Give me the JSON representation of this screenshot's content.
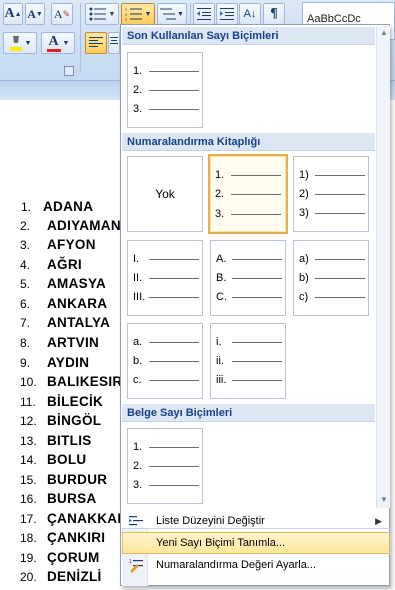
{
  "ribbon": {
    "grow_font_label": "A",
    "shrink_font_label": "A",
    "clear_format_label": "A",
    "font_color_label": "A",
    "styles_preview": "AaBbCcDc",
    "accent": "#c2d7f1"
  },
  "document": {
    "items": [
      {
        "number": "1.",
        "name": "ADANA"
      },
      {
        "number": "2.",
        "name": "ADIYAMAN"
      },
      {
        "number": "3.",
        "name": "AFYON"
      },
      {
        "number": "4.",
        "name": "AĞRI"
      },
      {
        "number": "5.",
        "name": "AMASYA"
      },
      {
        "number": "6.",
        "name": "ANKARA"
      },
      {
        "number": "7.",
        "name": "ANTALYA"
      },
      {
        "number": "8.",
        "name": "ARTVIN"
      },
      {
        "number": "9.",
        "name": "AYDIN"
      },
      {
        "number": "10.",
        "name": "BALIKESIR"
      },
      {
        "number": "11.",
        "name": "BİLECİK"
      },
      {
        "number": "12.",
        "name": "BİNGÖL"
      },
      {
        "number": "13.",
        "name": "BITLIS"
      },
      {
        "number": "14.",
        "name": "BOLU"
      },
      {
        "number": "15.",
        "name": "BURDUR"
      },
      {
        "number": "16.",
        "name": "BURSA"
      },
      {
        "number": "17.",
        "name": "ÇANAKKALE"
      },
      {
        "number": "18.",
        "name": "ÇANKIRI"
      },
      {
        "number": "19.",
        "name": "ÇORUM"
      },
      {
        "number": "20.",
        "name": "DENİZLİ"
      }
    ]
  },
  "gallery": {
    "recent_header": "Son Kullanılan Sayı Biçimleri",
    "library_header": "Numaralandırma Kitaplığı",
    "document_header": "Belge Sayı Biçimleri",
    "none_label": "Yok",
    "recent_tile": [
      "1.",
      "2.",
      "3."
    ],
    "library_tiles": [
      [
        "1.",
        "2.",
        "3."
      ],
      [
        "1)",
        "2)",
        "3)"
      ],
      [
        "I.",
        "II.",
        "III."
      ],
      [
        "A.",
        "B.",
        "C."
      ],
      [
        "a)",
        "b)",
        "c)"
      ],
      [
        "a.",
        "b.",
        "c."
      ],
      [
        "i.",
        "ii.",
        "iii."
      ]
    ],
    "document_tile": [
      "1.",
      "2.",
      "3."
    ],
    "selected_color": "#e6b04f"
  },
  "menu": {
    "change_level": "Liste Düzeyini Değiştir",
    "define_new": "Yeni Sayı Biçimi Tanımla...",
    "set_value": "Numaralandırma Değeri Ayarla...",
    "hover_color": "#ffe79b"
  }
}
